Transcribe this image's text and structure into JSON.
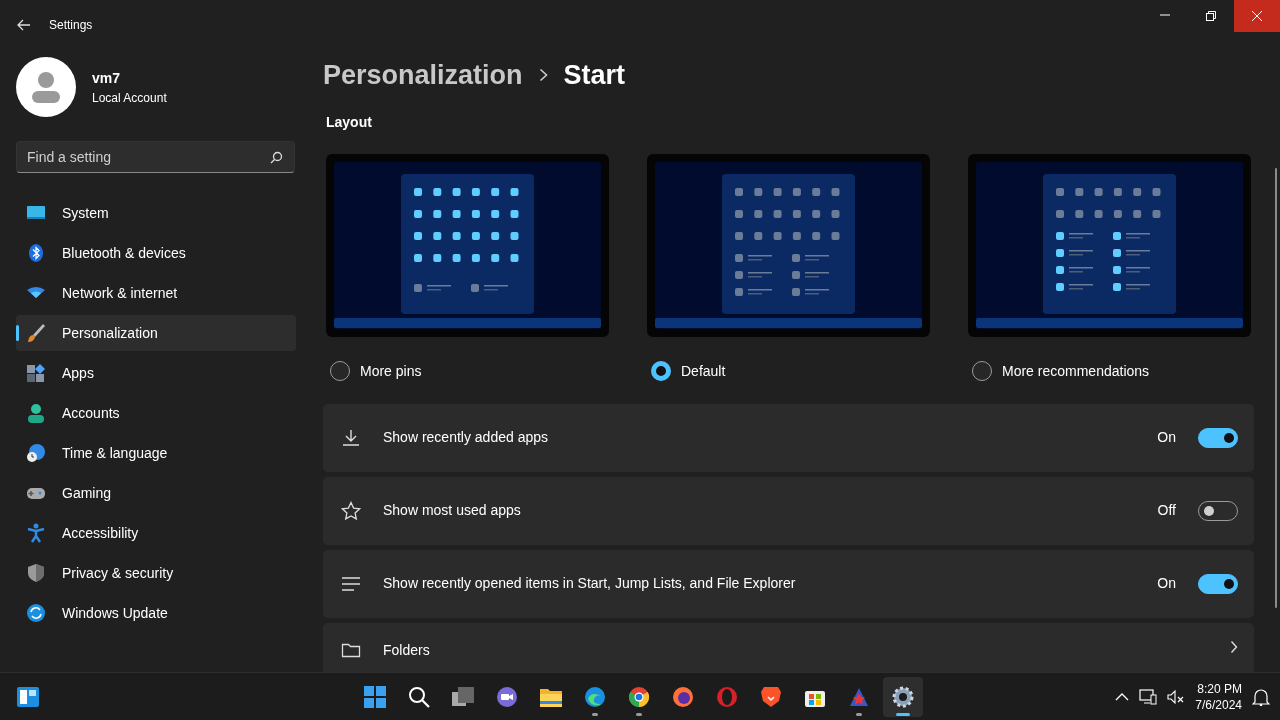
{
  "window": {
    "title": "Settings"
  },
  "profile": {
    "name": "vm7",
    "account": "Local Account"
  },
  "search": {
    "placeholder": "Find a setting"
  },
  "sidebar": {
    "items": [
      {
        "label": "System",
        "kind": "system",
        "selected": false
      },
      {
        "label": "Bluetooth & devices",
        "kind": "bluetooth",
        "selected": false
      },
      {
        "label": "Network & internet",
        "kind": "network",
        "selected": false
      },
      {
        "label": "Personalization",
        "kind": "brush",
        "selected": true
      },
      {
        "label": "Apps",
        "kind": "apps",
        "selected": false
      },
      {
        "label": "Accounts",
        "kind": "accounts",
        "selected": false
      },
      {
        "label": "Time & language",
        "kind": "time",
        "selected": false
      },
      {
        "label": "Gaming",
        "kind": "gaming",
        "selected": false
      },
      {
        "label": "Accessibility",
        "kind": "accessibility",
        "selected": false
      },
      {
        "label": "Privacy & security",
        "kind": "privacy",
        "selected": false
      },
      {
        "label": "Windows Update",
        "kind": "update",
        "selected": false
      }
    ]
  },
  "breadcrumb": [
    "Personalization",
    "Start"
  ],
  "layout": {
    "title": "Layout",
    "options": [
      {
        "label": "More pins",
        "kind": "more_pins",
        "selected": false
      },
      {
        "label": "Default",
        "kind": "default",
        "selected": true
      },
      {
        "label": "More recommendations",
        "kind": "more_recommendations",
        "selected": false
      }
    ]
  },
  "settings": [
    {
      "kind": "toggle",
      "label": "Show recently added apps",
      "state_text": "On",
      "on": true
    },
    {
      "kind": "toggle",
      "label": "Show most used apps",
      "state_text": "Off",
      "on": false
    },
    {
      "kind": "toggle",
      "label": "Show recently opened items in Start, Jump Lists, and File Explorer",
      "state_text": "On",
      "on": true
    },
    {
      "kind": "link",
      "label": "Folders"
    }
  ],
  "taskbar": {
    "apps": [
      {
        "kind": "start",
        "open": false,
        "active": false
      },
      {
        "kind": "search",
        "open": false,
        "active": false
      },
      {
        "kind": "taskview",
        "open": false,
        "active": false
      },
      {
        "kind": "chat",
        "open": false,
        "active": false
      },
      {
        "kind": "explorer",
        "open": false,
        "active": false
      },
      {
        "kind": "edge",
        "open": true,
        "active": false
      },
      {
        "kind": "chrome",
        "open": true,
        "active": false
      },
      {
        "kind": "firefox",
        "open": false,
        "active": false
      },
      {
        "kind": "opera",
        "open": false,
        "active": false
      },
      {
        "kind": "brave",
        "open": false,
        "active": false
      },
      {
        "kind": "store",
        "open": false,
        "active": false
      },
      {
        "kind": "stars",
        "open": true,
        "active": false
      },
      {
        "kind": "settings",
        "open": true,
        "active": true
      }
    ],
    "time": "8:20 PM",
    "date": "7/6/2024"
  }
}
